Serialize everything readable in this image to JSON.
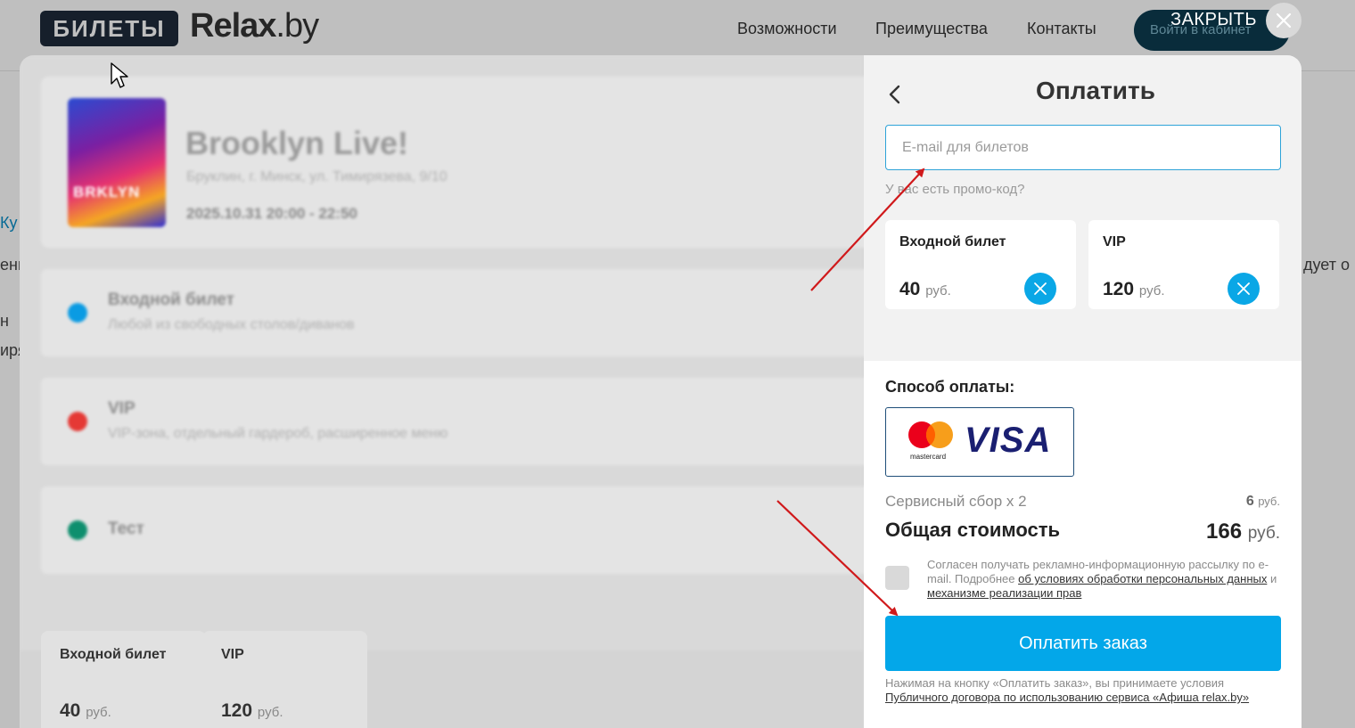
{
  "site": {
    "logo_badge": "БИЛЕТЫ",
    "logo_name": "Relax",
    "logo_suffix": ".by",
    "nav": [
      "Возможности",
      "Преимущества",
      "Контакты"
    ],
    "cabinet_button": "Войти в кабинет",
    "close_label": "ЗАКРЫТЬ"
  },
  "event": {
    "poster_label": "BRKLYN",
    "title": "Brooklyn Live!",
    "address": "Бруклин, г. Минск, ул. Тимирязева, 9/10",
    "datetime": "2025.10.31 20:00 - 22:50"
  },
  "ticket_types": [
    {
      "name": "Входной билет",
      "description": "Любой из свободных столов/диванов",
      "color": "#0a9be3"
    },
    {
      "name": "VIP",
      "description": "VIP-зона, отдельный гардероб, расширенное меню",
      "color": "#e53935"
    },
    {
      "name": "Тест",
      "description": "",
      "color": "#0e8f6e"
    }
  ],
  "bottom_cards": [
    {
      "name": "Входной билет",
      "price": "40",
      "currency": "руб."
    },
    {
      "name": "VIP",
      "price": "120",
      "currency": "руб."
    }
  ],
  "payment": {
    "title": "Оплатить",
    "email_placeholder": "E-mail для билетов",
    "promo_link": "У вас есть промо-код?",
    "selected": [
      {
        "name": "Входной билет",
        "price": "40",
        "currency": "руб."
      },
      {
        "name": "VIP",
        "price": "120",
        "currency": "руб."
      }
    ],
    "method_label": "Способ оплаты:",
    "mastercard_text": "mastercard",
    "visa_text": "VISA",
    "fee_label": "Сервисный сбор х 2",
    "fee_value": "6",
    "fee_currency": "руб.",
    "total_label": "Общая стоимость",
    "total_value": "166",
    "total_currency": "руб.",
    "consent_text": "Согласен получать рекламно-информационную рассылку по e-mail. Подробнее ",
    "consent_link1": "об условиях обработки персональных данных",
    "consent_and": " и ",
    "consent_link2": "механизме реализации прав",
    "pay_button": "Оплатить заказ",
    "legal_text": "Нажимая на кнопку «Оплатить заказ», вы принимаете условия ",
    "legal_link": "Публичного договора по использованию сервиса «Афиша relax.by»"
  },
  "background_fragments": [
    "Ку",
    "ени",
    "н",
    "иря",
    "дует о"
  ],
  "colors": {
    "accent": "#03a7e9",
    "arrow": "#d0191b",
    "brand_dark": "#1e2a3a"
  }
}
